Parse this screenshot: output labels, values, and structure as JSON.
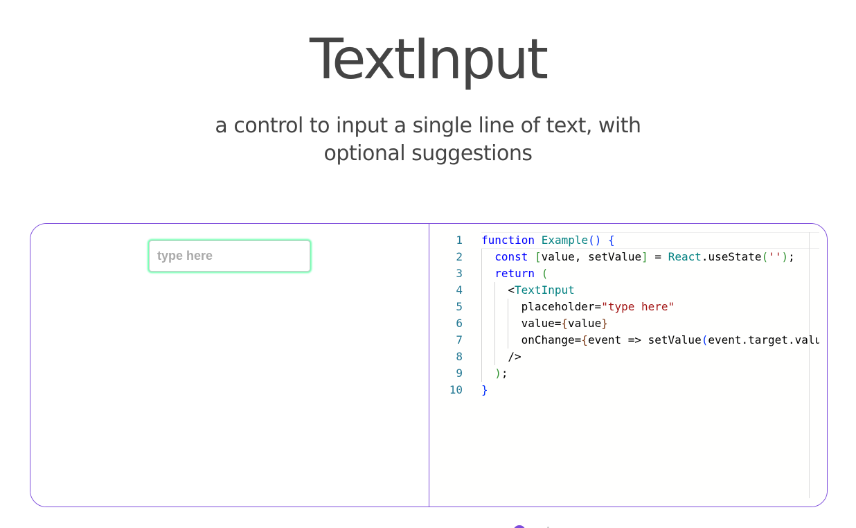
{
  "header": {
    "title": "TextInput",
    "subtitle": "a control to input a single line of text, with optional suggestions"
  },
  "preview": {
    "input": {
      "value": "",
      "placeholder": "type here"
    }
  },
  "code_editor": {
    "line_numbers": [
      "1",
      "2",
      "3",
      "4",
      "5",
      "6",
      "7",
      "8",
      "9",
      "10"
    ],
    "lines": [
      [
        [
          "function",
          "kw"
        ],
        [
          " ",
          "plain"
        ],
        [
          "Example",
          "cls"
        ],
        [
          "()",
          "p1"
        ],
        [
          " ",
          "plain"
        ],
        [
          "{",
          "p1"
        ]
      ],
      [
        [
          "const",
          "kw"
        ],
        [
          " ",
          "plain"
        ],
        [
          "[",
          "p2"
        ],
        [
          "value, setValue",
          "plain"
        ],
        [
          "]",
          "p2"
        ],
        [
          " = ",
          "plain"
        ],
        [
          "React",
          "cls"
        ],
        [
          ".useState",
          "plain"
        ],
        [
          "(",
          "p2"
        ],
        [
          "''",
          "str"
        ],
        [
          ")",
          "p2"
        ],
        [
          ";",
          "plain"
        ]
      ],
      [
        [
          "return",
          "kw"
        ],
        [
          " ",
          "plain"
        ],
        [
          "(",
          "p2"
        ]
      ],
      [
        [
          "<",
          "plain"
        ],
        [
          "TextInput",
          "cls"
        ]
      ],
      [
        [
          "placeholder=",
          "plain"
        ],
        [
          "\"type here\"",
          "str"
        ]
      ],
      [
        [
          "value=",
          "plain"
        ],
        [
          "{",
          "p3"
        ],
        [
          "value",
          "plain"
        ],
        [
          "}",
          "p3"
        ]
      ],
      [
        [
          "onChange=",
          "plain"
        ],
        [
          "{",
          "p3"
        ],
        [
          "event => setValue",
          "plain"
        ],
        [
          "(",
          "p1"
        ],
        [
          "event.target.value",
          "plain"
        ],
        [
          ")",
          "p1"
        ],
        [
          "}",
          "p3"
        ]
      ],
      [
        [
          "/>",
          "plain"
        ]
      ],
      [
        [
          ")",
          "p2"
        ],
        [
          ";",
          "plain"
        ]
      ],
      [
        [
          "}",
          "p1"
        ]
      ]
    ],
    "indents": [
      0,
      1,
      1,
      2,
      3,
      3,
      3,
      2,
      1,
      0
    ]
  },
  "colors": {
    "brand": "#7D4CDB",
    "focus": "#6FFFB0",
    "text": "#444444",
    "line_number": "#237893"
  }
}
